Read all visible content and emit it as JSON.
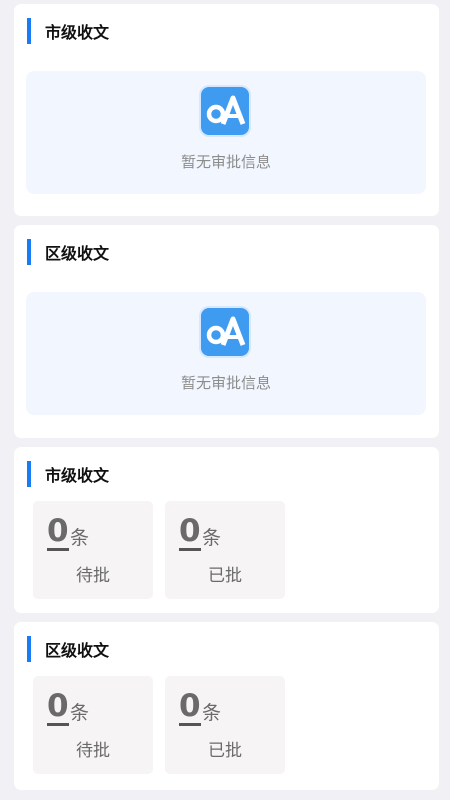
{
  "sections": [
    {
      "title": "市级收文",
      "empty_text": "暂无审批信息",
      "icon": "oa-app-icon"
    },
    {
      "title": "区级收文",
      "empty_text": "暂无审批信息",
      "icon": "oa-app-icon"
    },
    {
      "title": "市级收文",
      "stats": [
        {
          "value": "0",
          "unit": "条",
          "label": "待批"
        },
        {
          "value": "0",
          "unit": "条",
          "label": "已批"
        }
      ]
    },
    {
      "title": "区级收文",
      "stats": [
        {
          "value": "0",
          "unit": "条",
          "label": "待批"
        },
        {
          "value": "0",
          "unit": "条",
          "label": "已批"
        }
      ]
    }
  ],
  "colors": {
    "accent": "#1a7cf4",
    "icon_bg": "#3f9bf0",
    "empty_bg": "#f2f6ff",
    "stat_bg": "#f6f4f4"
  }
}
